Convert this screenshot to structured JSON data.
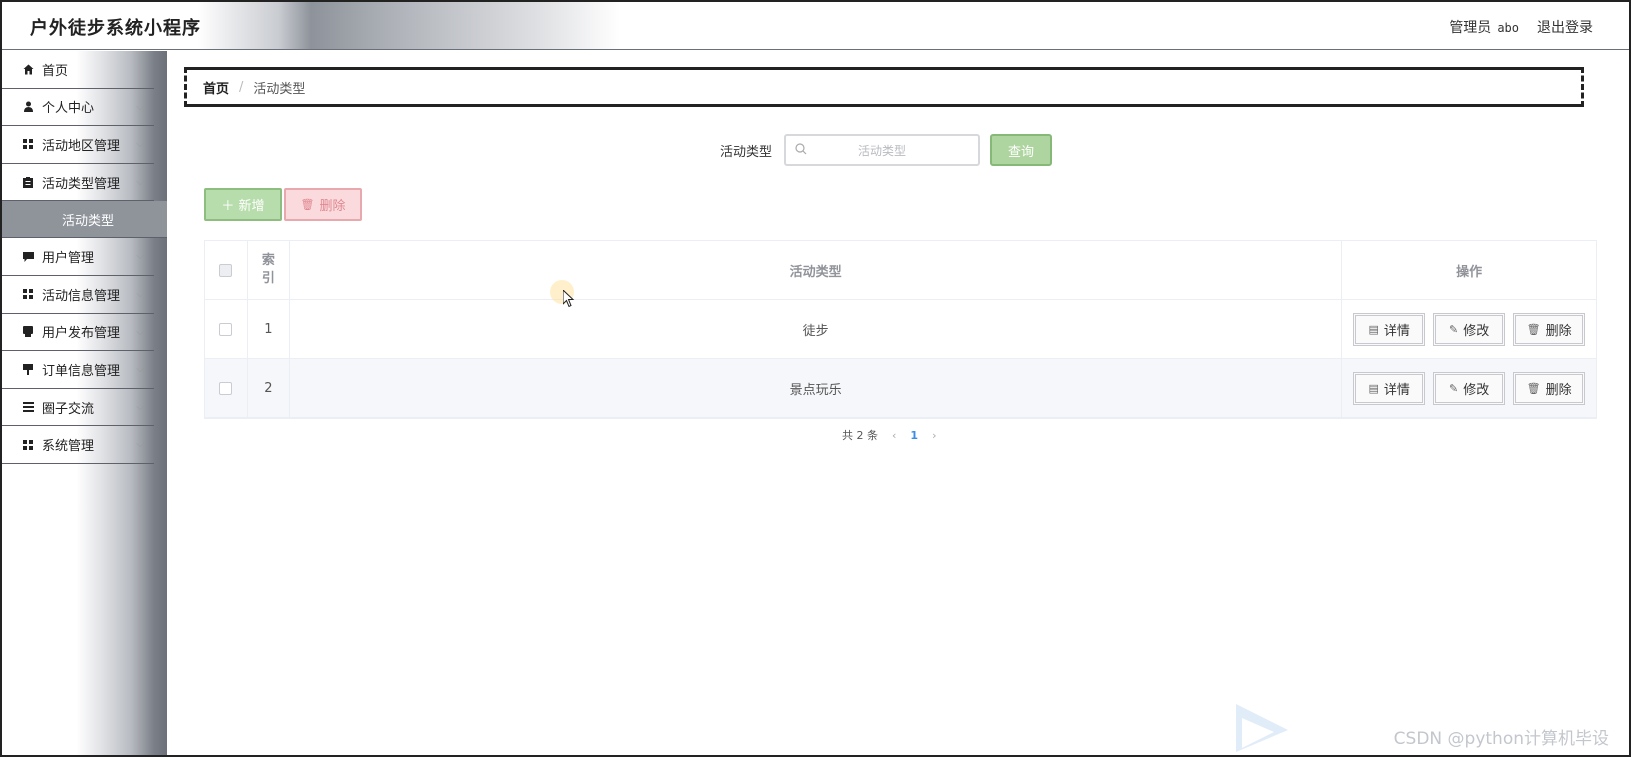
{
  "header": {
    "app_title": "户外徒步系统小程序",
    "admin_label": "管理员",
    "admin_name": "abo",
    "logout_label": "退出登录"
  },
  "sidebar": {
    "items": [
      {
        "label": "首页",
        "icon": "home-icon"
      },
      {
        "label": "个人中心",
        "icon": "user-icon"
      },
      {
        "label": "活动地区管理",
        "icon": "grid-icon"
      },
      {
        "label": "活动类型管理",
        "icon": "clipboard-icon"
      },
      {
        "label": "用户管理",
        "icon": "message-icon"
      },
      {
        "label": "活动信息管理",
        "icon": "grid-icon"
      },
      {
        "label": "用户发布管理",
        "icon": "document-icon"
      },
      {
        "label": "订单信息管理",
        "icon": "pin-icon"
      },
      {
        "label": "圈子交流",
        "icon": "list-icon"
      },
      {
        "label": "系统管理",
        "icon": "grid-icon"
      }
    ],
    "active_sub": "活动类型"
  },
  "breadcrumb": {
    "home": "首页",
    "separator": "/",
    "current": "活动类型"
  },
  "search": {
    "label": "活动类型",
    "placeholder": "活动类型",
    "query_label": "查询"
  },
  "actions": {
    "add_label": "＋ 新增",
    "delete_label": "删除"
  },
  "table": {
    "headers": {
      "index": "索引",
      "type": "活动类型",
      "ops": "操作"
    },
    "rows": [
      {
        "index": "1",
        "type": "徒步"
      },
      {
        "index": "2",
        "type": "景点玩乐"
      }
    ],
    "op_labels": {
      "detail": "详情",
      "edit": "修改",
      "delete": "删除"
    }
  },
  "pagination": {
    "total_text": "共 2 条",
    "current_page": "1"
  },
  "watermark": "CSDN @python计算机毕设",
  "colors": {
    "query_button": "#aed5a0",
    "add_button": "#b8ddac",
    "delete_button": "#fadadd",
    "active_sub_bg": "#8f949b"
  }
}
